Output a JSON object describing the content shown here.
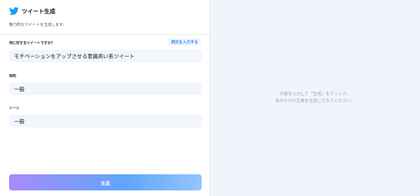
{
  "header": {
    "title": "ツイート生成",
    "subtitle": "魅力的なツイートを生成します。",
    "icon": "twitter-bird-icon",
    "brand_color": "#1d9bf0"
  },
  "form": {
    "field1_label": "何に対するツイートですか？",
    "example_button_label": "例文を入力する",
    "field1_value": "モチベーションをアップさせる意識高い系ツイート",
    "field2_label": "目的",
    "field2_value": "一般",
    "field3_label": "トーン",
    "field3_value": "一般",
    "submit_label": "生成"
  },
  "output": {
    "line1": "内容を入力して「生成」をクリック。",
    "line2": "自分だけの文章を生成してみてください。"
  }
}
